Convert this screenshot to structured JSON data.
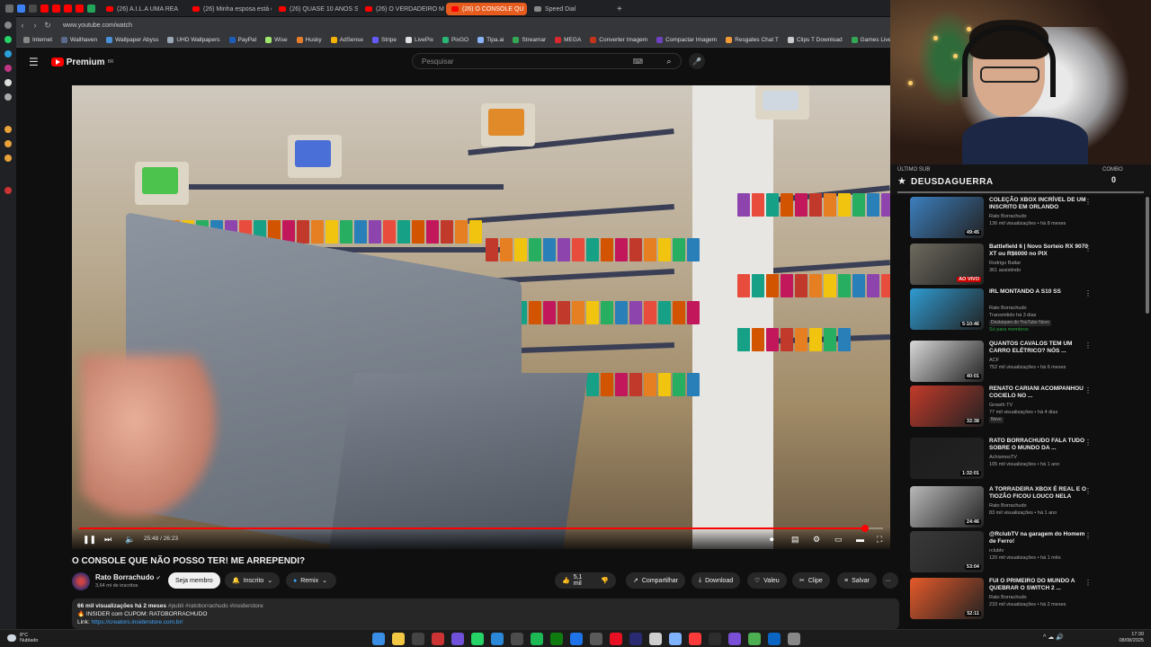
{
  "browser": {
    "tabs": [
      {
        "label": "(26) A.I.L.A UMA REA",
        "active": false
      },
      {
        "label": "(26) Minha esposa está c",
        "active": false
      },
      {
        "label": "(26) QUASE 10 ANOS SE",
        "active": false
      },
      {
        "label": "(26) O VERDADEIRO MO",
        "active": false
      },
      {
        "label": "(26) O CONSOLE QU",
        "active": true
      },
      {
        "label": "Speed Dial",
        "active": false
      }
    ],
    "new_tab": "+",
    "url": "www.youtube.com/watch",
    "bookmarks": [
      {
        "label": "Internet",
        "color": "#888888"
      },
      {
        "label": "Wallhaven",
        "color": "#5b6b8c"
      },
      {
        "label": "Wallpaper Abyss",
        "color": "#4a90d9"
      },
      {
        "label": "UHD Wallpapers",
        "color": "#9aa9b8"
      },
      {
        "label": "PayPal",
        "color": "#1e5db8"
      },
      {
        "label": "Wise",
        "color": "#9fe870"
      },
      {
        "label": "Husky",
        "color": "#e57d2b"
      },
      {
        "label": "AdSense",
        "color": "#f4b400"
      },
      {
        "label": "Stripe",
        "color": "#635bff"
      },
      {
        "label": "LivePix",
        "color": "#e0e0e0"
      },
      {
        "label": "PixGO",
        "color": "#2ab673"
      },
      {
        "label": "Tipa.ai",
        "color": "#8ab4f8"
      },
      {
        "label": "Streamar",
        "color": "#34a853"
      },
      {
        "label": "MEGA",
        "color": "#d9272e"
      },
      {
        "label": "Converter Imagem",
        "color": "#c1351d"
      },
      {
        "label": "Compactar Imagem",
        "color": "#6f42c1"
      },
      {
        "label": "Resgates Chat T",
        "color": "#f29b38"
      },
      {
        "label": "Clips T Download",
        "color": "#cccccc"
      },
      {
        "label": "Games Live",
        "color": "#34a853"
      },
      {
        "label": "Wa",
        "color": "#7e57c2"
      }
    ]
  },
  "youtube": {
    "logo_text": "Premium",
    "logo_sup": "BR",
    "search_placeholder": "Pesquisar"
  },
  "video": {
    "time": "25:48 / 26:23",
    "progress": 0.978,
    "title": "O CONSOLE QUE NÃO POSSO TER! ME ARREPENDI?",
    "channel": "Rato Borrachudo",
    "verified": "✔",
    "subscribers": "3,64 mi de inscritos",
    "buttons": {
      "join": "Seja membro",
      "subscribed": "Inscrito",
      "remix": "Remix",
      "likes": "5,1 mil",
      "share": "Compartilhar",
      "download": "Download",
      "thanks": "Valeu",
      "clip": "Clipe",
      "save": "Salvar",
      "more": "···"
    },
    "description": {
      "stats": "66 mil visualizações  há 2 meses",
      "tags": "#publi #ratoborrachudo #insiderstore",
      "line2": "INSIDER com CUPOM: RATOBORRACHUDO",
      "link_prefix": "Link: ",
      "link": "https://creators.insiderstore.com.br/"
    }
  },
  "stream_overlay": {
    "last_sub_label": "ÚLTIMO SUB",
    "last_sub_name": "DEUSDAGUERRA",
    "combo_label": "COMBO",
    "combo_value": "0"
  },
  "related": [
    {
      "title": "COLEÇÃO XBOX INCRÍVEL DE UM INSCRITO EM ORLANDO",
      "channel": "Rato Borrachudo",
      "meta": "136 mil visualizações • há 8 meses",
      "duration": "49:45",
      "live": false,
      "badge": "",
      "thumb": "#3c7fbf"
    },
    {
      "title": "Battlefield 6 | Novo Sorteio RX 9070 XT ou R$6000 no PIX",
      "channel": "Rodrigo Baltar",
      "meta": "361 assistindo",
      "duration": "AO VIVO",
      "live": true,
      "badge": "",
      "thumb": "#6d6a5e"
    },
    {
      "title": "IRL MONTANDO A S10 SS",
      "channel": "Rato Borrachudo",
      "meta": "Transmitido há 3 dias",
      "duration": "5:10:46",
      "live": false,
      "badge": "Destaques do YouTube  Novo",
      "extra": "Só para membros",
      "thumb": "#2f9bd1"
    },
    {
      "title": "QUANTOS CAVALOS TEM UM CARRO ELÉTRICO? NÓS ...",
      "channel": "ACF",
      "meta": "752 mil visualizações • há 6 meses",
      "duration": "40:01",
      "live": false,
      "badge": "",
      "thumb": "#d8d8d8"
    },
    {
      "title": "RENATO CARIANI ACOMPANHOU COCIELO NO ...",
      "channel": "Growth TV",
      "meta": "77 mil visualizações • há 4 dias",
      "duration": "32:38",
      "live": false,
      "badge": "Novo",
      "thumb": "#c23a2a"
    },
    {
      "title": "RATO BORRACHUDO FALA TUDO SOBRE O MUNDO DA ...",
      "channel": "AchismosTV",
      "meta": "105 mil visualizações • há 1 ano",
      "duration": "1:32:01",
      "live": false,
      "badge": "",
      "thumb": "#1d1d1d"
    },
    {
      "title": "A TORRADEIRA XBOX É REAL E O TIOZÃO FICOU LOUCO NELA",
      "channel": "Rato Borrachudo",
      "meta": "83 mil visualizações • há 1 ano",
      "duration": "24:46",
      "live": false,
      "badge": "",
      "thumb": "#b8b8b8"
    },
    {
      "title": "@RclubTV na garagem do Homem de Ferro!",
      "channel": "rclubtv",
      "meta": "120 mil visualizações • há 1 mês",
      "duration": "53:04",
      "live": false,
      "badge": "",
      "thumb": "#3a3a3a"
    },
    {
      "title": "FUI O PRIMEIRO DO MUNDO A QUEBRAR O SWITCH 2 ...",
      "channel": "Rato Borrachudo",
      "meta": "233 mil visualizações • há 2 meses",
      "duration": "52:11",
      "live": false,
      "badge": "",
      "thumb": "#e65a2a"
    }
  ],
  "taskbar": {
    "temp": "8°C",
    "weather": "Nublado",
    "time": "17:30",
    "date": "08/08/2025",
    "tray": "^  ☁  🔊"
  }
}
